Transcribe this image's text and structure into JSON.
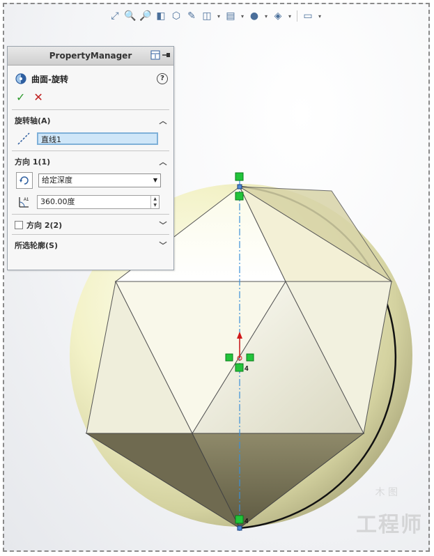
{
  "toolbar": {
    "icons": [
      "zoom-fit-icon",
      "zoom-area-icon",
      "zoom-previous-icon",
      "section-view-icon",
      "view-orientation-icon",
      "dynamic-annotation-icon",
      "display-style-icon",
      "hide-show-icon",
      "edit-appearance-icon",
      "apply-scene-icon",
      "view-settings-icon",
      "screen-capture-icon"
    ]
  },
  "property_manager": {
    "title": "PropertyManager",
    "feature_name": "曲面-旋转",
    "help": "?",
    "ok": "✓",
    "cancel": "✕",
    "sections": {
      "axis": {
        "label": "旋转轴(A)",
        "value": "直线1"
      },
      "direction1": {
        "label": "方向 1(1)",
        "type": "给定深度",
        "angle": "360.00度"
      },
      "direction2": {
        "label": "方向 2(2)",
        "checked": false
      },
      "contours": {
        "label": "所选轮廓(S)"
      }
    }
  },
  "viewport": {
    "marker_labels": [
      "4",
      "4"
    ]
  },
  "watermark": {
    "text": "工程师",
    "small": "木 图"
  },
  "colors": {
    "ok": "#2e9a2e",
    "cancel": "#c02020",
    "selection_bg": "#cfe6f8",
    "axis_line": "#3a8fd8",
    "constraint": "#22c43a",
    "surface_light": "#f3f2c8",
    "surface_dark": "#6e6a4e"
  }
}
